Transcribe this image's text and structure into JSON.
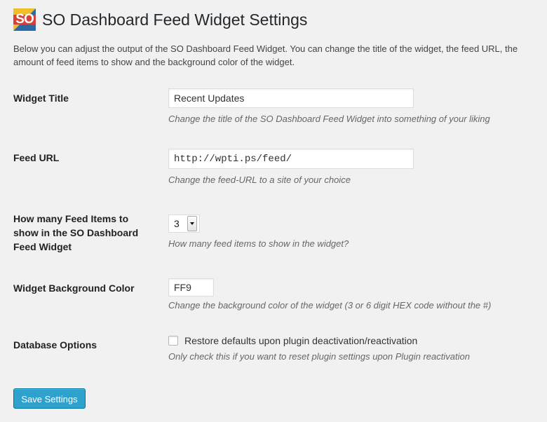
{
  "header": {
    "logo_text": "SO",
    "title": "SO Dashboard Feed Widget Settings"
  },
  "intro": "Below you can adjust the output of the SO Dashboard Feed Widget. You can change the title of the widget, the feed URL, the amount of feed items to show and the background color of the widget.",
  "settings": {
    "widget_title": {
      "label": "Widget Title",
      "value": "Recent Updates",
      "description": "Change the title of the SO Dashboard Feed Widget into something of your liking"
    },
    "feed_url": {
      "label": "Feed URL",
      "value": "http://wpti.ps/feed/",
      "description": "Change the feed-URL to a site of your choice"
    },
    "feed_items": {
      "label": "How many Feed Items to show in the SO Dashboard Feed Widget",
      "selected": "3",
      "description": "How many feed items to show in the widget?"
    },
    "background_color": {
      "label": "Widget Background Color",
      "value": "FF9",
      "description": "Change the background color of the widget (3 or 6 digit HEX code without the #)"
    },
    "database_options": {
      "label": "Database Options",
      "checkbox_label": "Restore defaults upon plugin deactivation/reactivation",
      "checked": false,
      "description": "Only check this if you want to reset plugin settings upon Plugin reactivation"
    }
  },
  "save_button": "Save Settings",
  "colors": {
    "page_background": "#f1f1f1",
    "logo_blue": "#2b6aa5",
    "logo_gold": "#f3bd2a",
    "logo_red": "#d4423a",
    "button_primary": "#2ea2cc"
  }
}
